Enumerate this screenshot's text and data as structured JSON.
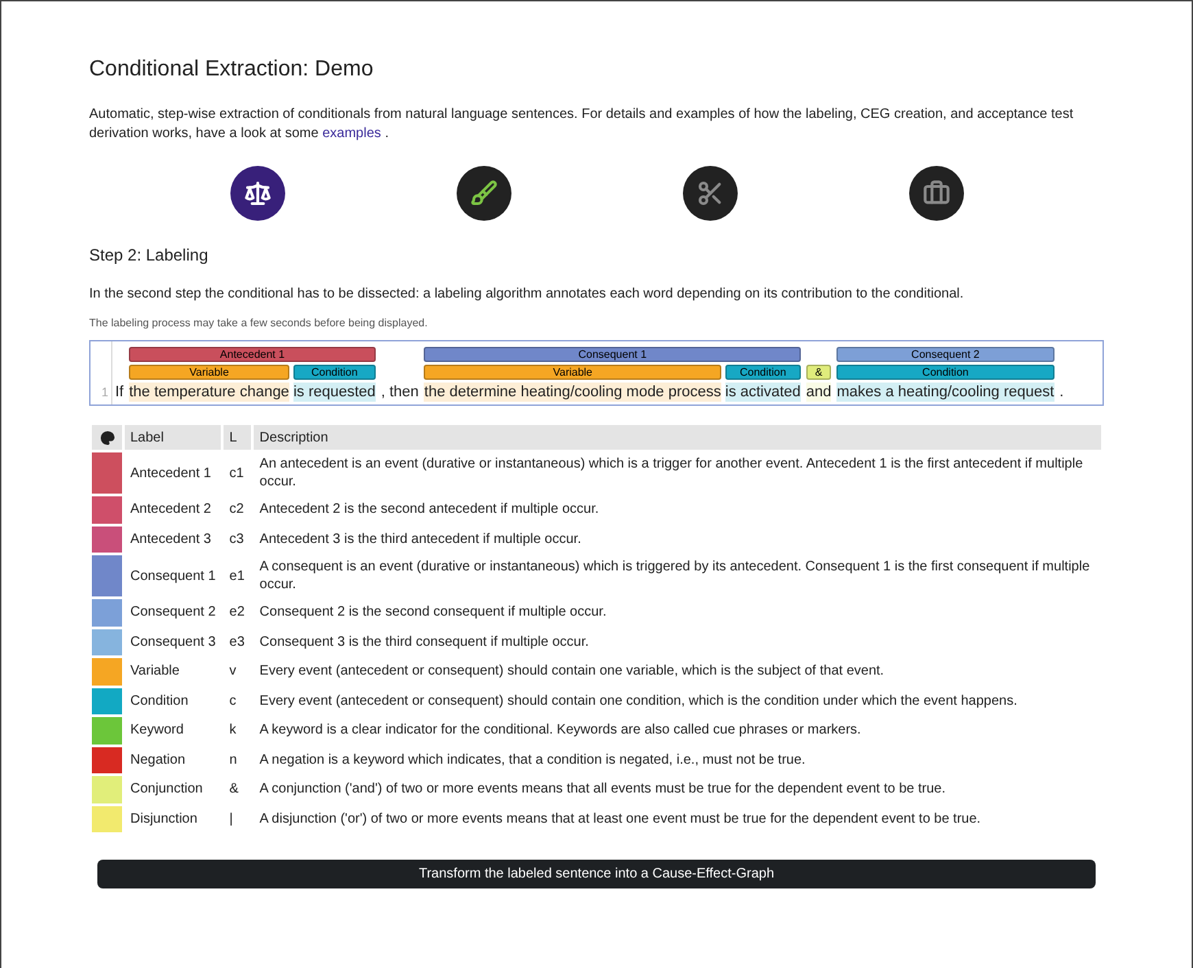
{
  "title": "Conditional Extraction: Demo",
  "intro": {
    "text": "Automatic, step-wise extraction of conditionals from natural language sentences. For details and examples of how the labeling, CEG creation, and acceptance test derivation works, have a look at some",
    "link": "examples",
    "after": "."
  },
  "steps": [
    {
      "selected": true
    },
    {
      "selected": false
    },
    {
      "selected": false
    },
    {
      "selected": false
    }
  ],
  "step_title": "Step 2: Labeling",
  "step_text": "In the second step the conditional has to be dissected: a labeling algorithm annotates each word depending on its contribution to the conditional.",
  "note": "The labeling process may take a few seconds before being displayed.",
  "annotation": {
    "line_number": "1",
    "segments": [
      {
        "kind": "plain",
        "text": "If"
      },
      {
        "kind": "event",
        "label": "Antecedent 1",
        "color": "#c94f5c",
        "parts": [
          {
            "label": "Variable",
            "text": "the temperature change",
            "color": "#f5a623"
          },
          {
            "label": "Condition",
            "text": "is requested",
            "color": "#17a8c4"
          }
        ]
      },
      {
        "kind": "plain",
        "text": ", then"
      },
      {
        "kind": "event",
        "label": "Consequent 1",
        "color": "#7087c9",
        "parts": [
          {
            "label": "Variable",
            "text": "the determine heating/cooling mode process",
            "color": "#f5a623"
          },
          {
            "label": "Condition",
            "text": "is activated",
            "color": "#17a8c4"
          }
        ]
      },
      {
        "kind": "event",
        "parts": [
          {
            "label": "&",
            "text": "and",
            "color": "#e0ec7c"
          }
        ]
      },
      {
        "kind": "event",
        "label": "Consequent 2",
        "color": "#7d9fd6",
        "parts": [
          {
            "label": "Condition",
            "text": "makes a heating/cooling request",
            "color": "#17a8c4"
          }
        ]
      },
      {
        "kind": "plain",
        "text": "."
      }
    ]
  },
  "table": {
    "columns": [
      "Label",
      "L",
      "Description"
    ],
    "rows": [
      {
        "label": "Antecedent 1",
        "code": "c1",
        "description": "An antecedent is an event (durative or instantaneous) which is a trigger for another event. Antecedent 1 is the first antecedent if multiple occur.",
        "color": "#cd4f5e"
      },
      {
        "label": "Antecedent 2",
        "code": "c2",
        "description": "Antecedent 2 is the second antecedent if multiple occur.",
        "color": "#cf4f6a"
      },
      {
        "label": "Antecedent 3",
        "code": "c3",
        "description": "Antecedent 3 is the third antecedent if multiple occur.",
        "color": "#c94f7a"
      },
      {
        "label": "Consequent 1",
        "code": "e1",
        "description": "A consequent is an event (durative or instantaneous) which is triggered by its antecedent. Consequent 1 is the first consequent if multiple occur.",
        "color": "#7087c9"
      },
      {
        "label": "Consequent 2",
        "code": "e2",
        "description": "Consequent 2 is the second consequent if multiple occur.",
        "color": "#7ca0d8"
      },
      {
        "label": "Consequent 3",
        "code": "e3",
        "description": "Consequent 3 is the third consequent if multiple occur.",
        "color": "#86b4de"
      },
      {
        "label": "Variable",
        "code": "v",
        "description": "Every event (antecedent or consequent) should contain one variable, which is the subject of that event.",
        "color": "#f5a623"
      },
      {
        "label": "Condition",
        "code": "c",
        "description": "Every event (antecedent or consequent) should contain one condition, which is the condition under which the event happens.",
        "color": "#12a9c3"
      },
      {
        "label": "Keyword",
        "code": "k",
        "description": "A keyword is a clear indicator for the conditional. Keywords are also called cue phrases or markers.",
        "color": "#6cc63a"
      },
      {
        "label": "Negation",
        "code": "n",
        "description": "A negation is a keyword which indicates, that a condition is negated, i.e., must not be true.",
        "color": "#d82a22"
      },
      {
        "label": "Conjunction",
        "code": "&",
        "description": "A conjunction ('and') of two or more events means that all events must be true for the dependent event to be true.",
        "color": "#e1ee7a"
      },
      {
        "label": "Disjunction",
        "code": "|",
        "description": "A disjunction ('or') of two or more events means that at least one event must be true for the dependent event to be true.",
        "color": "#f2ea6e"
      }
    ]
  },
  "button": "Transform the labeled sentence into a Cause-Effect-Graph"
}
